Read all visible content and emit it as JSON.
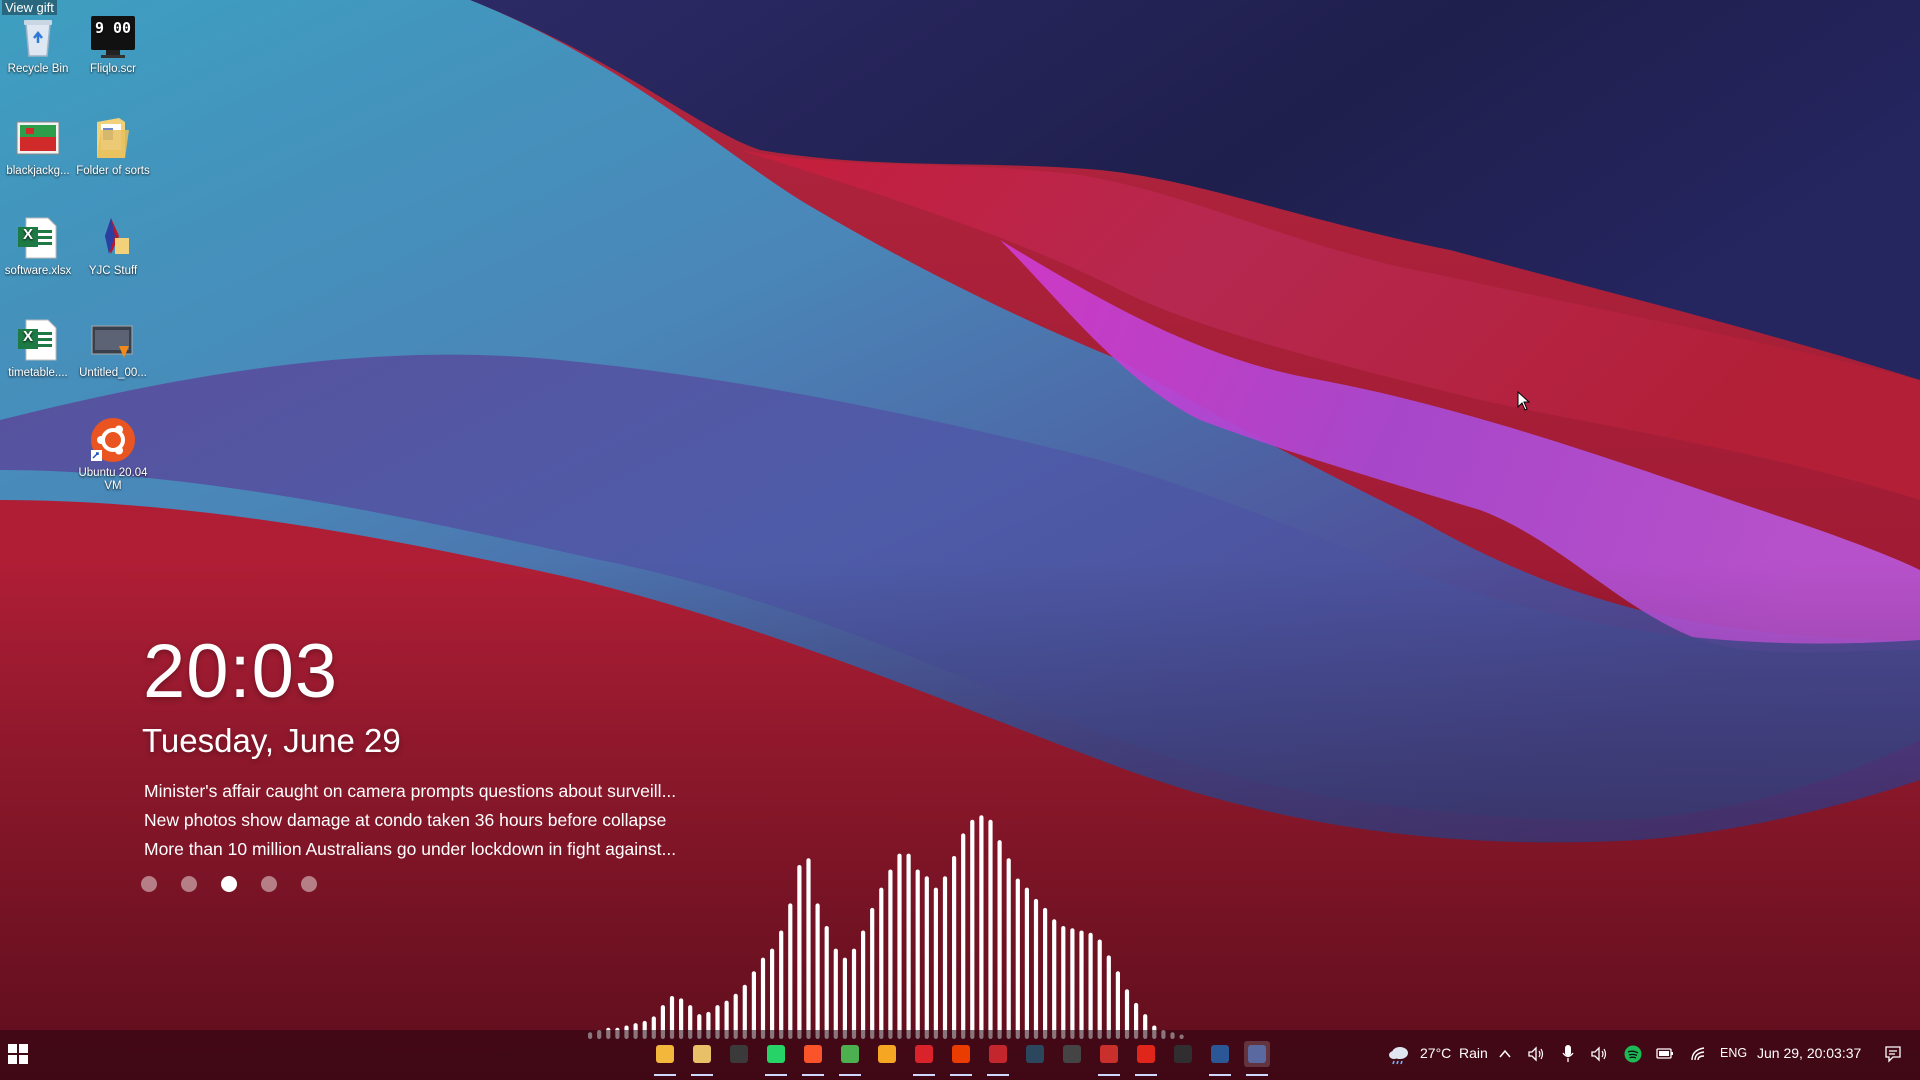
{
  "tooltip": {
    "text": "View gift"
  },
  "desktop": {
    "icons": [
      {
        "label": "Recycle Bin",
        "icon": "recycle-bin-icon"
      },
      {
        "label": "Fliqlo.scr",
        "icon": "fliqlo-clock-icon",
        "clock_text": "9 00"
      },
      {
        "label": "blackjackg...",
        "icon": "image-file-icon"
      },
      {
        "label": "Folder of sorts",
        "icon": "folder-icon"
      },
      {
        "label": "software.xlsx",
        "icon": "excel-file-icon",
        "badge": "X"
      },
      {
        "label": "YJC Stuff",
        "icon": "shortcut-folder-icon"
      },
      {
        "label": "timetable....",
        "icon": "excel-file-icon",
        "badge": "X"
      },
      {
        "label": "Untitled_00...",
        "icon": "video-file-icon"
      },
      {
        "label": "Ubuntu 20.04 VM",
        "icon": "ubuntu-icon"
      }
    ]
  },
  "widget": {
    "time": "20:03",
    "date": "Tuesday, June 29",
    "headlines": [
      "Minister's affair caught on camera prompts questions about surveill...",
      "New photos show damage at condo taken 36 hours before collapse",
      "More than 10 million Australians go under lockdown in fight against..."
    ],
    "page_count": 5,
    "active_page": 3
  },
  "visualizer": {
    "bar_levels": [
      0.03,
      0.04,
      0.05,
      0.05,
      0.06,
      0.07,
      0.08,
      0.1,
      0.15,
      0.19,
      0.18,
      0.15,
      0.11,
      0.12,
      0.15,
      0.17,
      0.2,
      0.24,
      0.3,
      0.36,
      0.4,
      0.48,
      0.6,
      0.77,
      0.8,
      0.6,
      0.5,
      0.4,
      0.36,
      0.4,
      0.48,
      0.58,
      0.67,
      0.75,
      0.82,
      0.82,
      0.75,
      0.72,
      0.67,
      0.72,
      0.81,
      0.91,
      0.97,
      0.99,
      0.97,
      0.88,
      0.8,
      0.71,
      0.67,
      0.62,
      0.58,
      0.53,
      0.5,
      0.49,
      0.48,
      0.47,
      0.44,
      0.37,
      0.3,
      0.22,
      0.16,
      0.11,
      0.06,
      0.04,
      0.03,
      0.02
    ]
  },
  "taskbar": {
    "apps": [
      {
        "name": "file-explorer-icon",
        "color": "#f3b73b"
      },
      {
        "name": "folder-icon",
        "color": "#e8c068"
      },
      {
        "name": "terminal-icon",
        "color": "#3a3a3a"
      },
      {
        "name": "whatsapp-icon",
        "color": "#25d366"
      },
      {
        "name": "brave-icon",
        "color": "#fb542b"
      },
      {
        "name": "chrome-icon",
        "color": "#4caf50"
      },
      {
        "name": "chat-icon",
        "color": "#f5a623"
      },
      {
        "name": "red-app-icon",
        "color": "#d9222a"
      },
      {
        "name": "office-icon",
        "color": "#eb3c00"
      },
      {
        "name": "calendar-icon",
        "color": "#c4262e"
      },
      {
        "name": "steam-icon",
        "color": "#2a475e"
      },
      {
        "name": "window-app-icon",
        "color": "#444444"
      },
      {
        "name": "games-icon",
        "color": "#c9302c"
      },
      {
        "name": "acrobat-icon",
        "color": "#e0251b"
      },
      {
        "name": "obs-icon",
        "color": "#302e31"
      },
      {
        "name": "word-icon",
        "color": "#2b5797"
      },
      {
        "name": "search-app-icon",
        "color": "#5a6aa0"
      }
    ],
    "weather": {
      "temp": "27°C",
      "condition": "Rain"
    },
    "language": "ENG",
    "datetime": "Jun 29, 20:03:37"
  }
}
